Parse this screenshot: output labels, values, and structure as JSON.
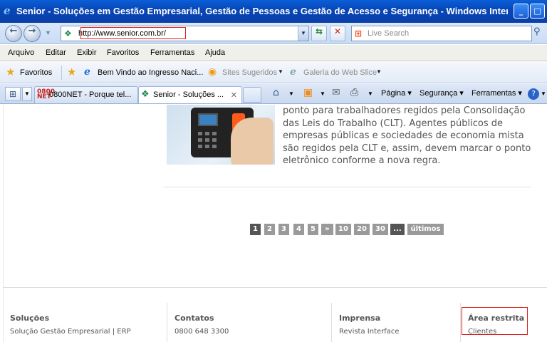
{
  "window": {
    "title": "Senior - Soluções em Gestão Empresarial, Gestão de Pessoas e Gestão de Acesso e Segurança - Windows Intern...",
    "app_icon": "ie-logo-icon",
    "minimize": "_",
    "maximize": "□"
  },
  "address_bar": {
    "url": "http://www.senior.com.br/",
    "site_icon": "senior-logo-icon"
  },
  "search": {
    "placeholder": "Live Search",
    "provider_icon": "windows-live-icon"
  },
  "menu": [
    "Arquivo",
    "Editar",
    "Exibir",
    "Favoritos",
    "Ferramentas",
    "Ajuda"
  ],
  "favorites_bar": {
    "favorites_label": "Favoritos",
    "items": [
      {
        "label": "Bem Vindo ao Ingresso Naci...",
        "icon": "ie-page-icon",
        "greyed": false
      },
      {
        "label": "Sites Sugeridos",
        "icon": "suggested-sites-icon",
        "greyed": true
      },
      {
        "label": "Galeria do Web Slice",
        "icon": "ie-page-icon",
        "greyed": true
      }
    ]
  },
  "tabs": [
    {
      "label": "0800NET - Porque tel...",
      "icon": "0800net-icon",
      "active": false
    },
    {
      "label": "Senior - Soluções ...",
      "icon": "senior-logo-icon",
      "active": true
    }
  ],
  "command_bar": {
    "pagina": "Página",
    "seguranca": "Segurança",
    "ferramentas": "Ferramentas"
  },
  "content": {
    "paragraph": "ponto para trabalhadores regidos pela Consolidação das Leis do Trabalho (CLT). Agentes públicos de empresas públicas e sociedades de economia mista são regidos pela CLT e, assim, devem marcar o ponto eletrônico conforme a nova regra.",
    "pagination": [
      "1",
      "2",
      "3",
      "4",
      "5",
      "»",
      "10",
      "20",
      "30",
      "...",
      "últimos »"
    ],
    "current_page": "1"
  },
  "footer": {
    "columns": [
      {
        "heading": "Soluções",
        "link": "Solução Gestão Empresarial | ERP"
      },
      {
        "heading": "Contatos",
        "link": "0800 648 3300"
      },
      {
        "heading": "Imprensa",
        "link": "Revista Interface"
      },
      {
        "heading": "Área restrita",
        "link": "Clientes"
      }
    ]
  },
  "colors": {
    "titlebar": "#0a47b8",
    "highlight_box": "#e0201a",
    "pager_bg": "#9a9a9a",
    "pager_current": "#555555"
  }
}
